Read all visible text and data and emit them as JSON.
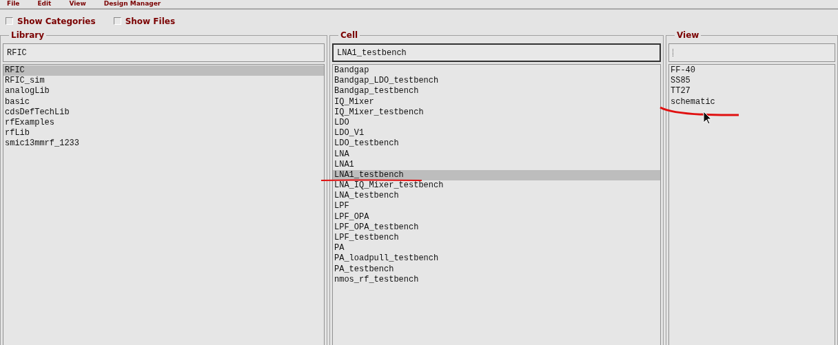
{
  "menu": [
    "File",
    "Edit",
    "View",
    "Design Manager"
  ],
  "options": [
    {
      "label": "Show Categories",
      "checked": false
    },
    {
      "label": "Show Files",
      "checked": false
    }
  ],
  "panes": [
    {
      "title": "Library",
      "value": "RFIC",
      "focused": false,
      "items": [
        {
          "label": "RFIC",
          "selected": true
        },
        {
          "label": "RFIC_sim",
          "selected": false
        },
        {
          "label": "analogLib",
          "selected": false
        },
        {
          "label": "basic",
          "selected": false
        },
        {
          "label": "cdsDefTechLib",
          "selected": false
        },
        {
          "label": "rfExamples",
          "selected": false
        },
        {
          "label": "rfLib",
          "selected": false
        },
        {
          "label": "smic13mmrf_1233",
          "selected": false
        }
      ]
    },
    {
      "title": "Cell",
      "value": "LNA1_testbench",
      "focused": true,
      "items": [
        {
          "label": "Bandgap",
          "selected": false
        },
        {
          "label": "Bandgap_LDO_testbench",
          "selected": false
        },
        {
          "label": "Bandgap_testbench",
          "selected": false
        },
        {
          "label": "IQ_Mixer",
          "selected": false
        },
        {
          "label": "IQ_Mixer_testbench",
          "selected": false
        },
        {
          "label": "LDO",
          "selected": false
        },
        {
          "label": "LDO_V1",
          "selected": false
        },
        {
          "label": "LDO_testbench",
          "selected": false
        },
        {
          "label": "LNA",
          "selected": false
        },
        {
          "label": "LNA1",
          "selected": false
        },
        {
          "label": "LNA1_testbench",
          "selected": true
        },
        {
          "label": "LNA_IQ_Mixer_testbench",
          "selected": false
        },
        {
          "label": "LNA_testbench",
          "selected": false
        },
        {
          "label": "LPF",
          "selected": false
        },
        {
          "label": "LPF_OPA",
          "selected": false
        },
        {
          "label": "LPF_OPA_testbench",
          "selected": false
        },
        {
          "label": "LPF_testbench",
          "selected": false
        },
        {
          "label": "PA",
          "selected": false
        },
        {
          "label": "PA_loadpull_testbench",
          "selected": false
        },
        {
          "label": "PA_testbench",
          "selected": false
        },
        {
          "label": "nmos_rf_testbench",
          "selected": false
        }
      ]
    },
    {
      "title": "View",
      "focused": false,
      "items": [
        {
          "label": "FF-40",
          "selected": false
        },
        {
          "label": "SS85",
          "selected": false
        },
        {
          "label": "TT27",
          "selected": false
        },
        {
          "label": "schematic",
          "selected": false
        }
      ]
    }
  ]
}
